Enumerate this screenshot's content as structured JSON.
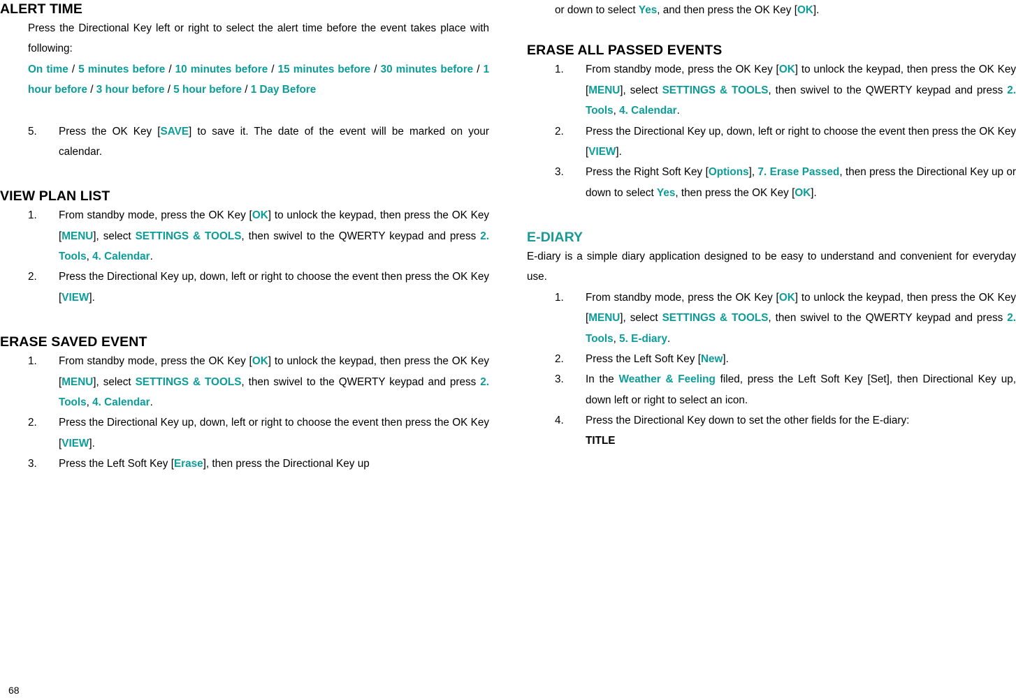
{
  "page_number": "68",
  "left_column": {
    "alert_time": {
      "heading": "ALERT TIME",
      "intro_line1": "Press the Directional Key left or right to select the alert time before the",
      "intro_line2": "event takes place with following:",
      "options": [
        "On time",
        "5 minutes before",
        "10 minutes before",
        "15 minutes before",
        "30 minutes before",
        "1 hour before",
        "3 hour before",
        "5 hour before",
        "1 Day Before"
      ],
      "step5_num": "5.",
      "step5_a": "Press the OK Key [",
      "step5_key": "SAVE",
      "step5_b": "] to save it. The date of the event will be marked on your calendar."
    },
    "view_plan_list": {
      "heading": "VIEW PLAN LIST",
      "step1": {
        "num": "1.",
        "t1": "From standby mode, press the OK Key [",
        "k1": "OK",
        "t2": "] to unlock the keypad, then press the OK Key [",
        "k2": "MENU",
        "t3": "], select ",
        "k3": "SETTINGS & TOOLS",
        "t4": ", then swivel to the QWERTY keypad and press ",
        "k4": "2. Tools",
        "t5": ", ",
        "k5": "4. Calendar",
        "t6": "."
      },
      "step2": {
        "num": "2.",
        "t1": "Press the Directional Key up, down, left or right to choose the event then press the OK Key [",
        "k1": "VIEW",
        "t2": "]."
      }
    },
    "erase_saved_event": {
      "heading": "ERASE SAVED EVENT",
      "step1": {
        "num": "1.",
        "t1": "From standby mode, press the OK Key [",
        "k1": "OK",
        "t2": "] to unlock the keypad, then press the OK Key [",
        "k2": "MENU",
        "t3": "], select ",
        "k3": "SETTINGS & TOOLS",
        "t4": ", then swivel to the QWERTY keypad and press ",
        "k4": "2. Tools",
        "t5": ", ",
        "k5": "4. Calendar",
        "t6": "."
      },
      "step2": {
        "num": "2.",
        "t1": "Press the Directional Key up, down, left or right to choose the event then press the OK Key [",
        "k1": "VIEW",
        "t2": "]."
      },
      "step3": {
        "num": "3.",
        "t1": "Press the Left Soft Key [",
        "k1": "Erase",
        "t2": "], then press the Directional Key up"
      }
    }
  },
  "right_column": {
    "continued": {
      "t1": "or down to select ",
      "k1": "Yes",
      "t2": ", and then press the OK Key [",
      "k2": "OK",
      "t3": "]."
    },
    "erase_all_passed": {
      "heading": "ERASE ALL PASSED EVENTS",
      "step1": {
        "num": "1.",
        "t1": "From standby mode, press the OK Key [",
        "k1": "OK",
        "t2": "] to unlock the keypad, then press the OK Key [",
        "k2": "MENU",
        "t3": "], select ",
        "k3": "SETTINGS & TOOLS",
        "t4": ", then swivel to the QWERTY keypad and press ",
        "k4": "2. Tools",
        "t5": ", ",
        "k5": "4. Calendar",
        "t6": "."
      },
      "step2": {
        "num": "2.",
        "t1": "Press the Directional Key up, down, left or right to choose the event then press the OK Key [",
        "k1": "VIEW",
        "t2": "]."
      },
      "step3": {
        "num": "3.",
        "t1": "Press the Right Soft Key [",
        "k1": "Options",
        "t2": "], ",
        "k2": "7. Erase Passed",
        "t3": ", then press the Directional Key up or down to select ",
        "k3": "Yes",
        "t4": ", then press the OK Key [",
        "k4": "OK",
        "t5": "]."
      }
    },
    "e_diary": {
      "heading": "E-DIARY",
      "intro_line1": "E-diary is a simple diary application designed to be easy to understand and",
      "intro_line2": "convenient for everyday use.",
      "step1": {
        "num": "1.",
        "t1": "From standby mode, press the OK Key [",
        "k1": "OK",
        "t2": "] to unlock the keypad, then press the OK Key [",
        "k2": "MENU",
        "t3": "], select ",
        "k3": "SETTINGS & TOOLS",
        "t4": ", then swivel to the QWERTY keypad and press ",
        "k4": "2. Tools",
        "t5": ", ",
        "k5": "5. E-diary",
        "t6": "."
      },
      "step2": {
        "num": "2.",
        "t1": "Press the Left Soft Key [",
        "k1": "New",
        "t2": "]."
      },
      "step3": {
        "num": "3.",
        "t1": "In the ",
        "k1": "Weather & Feeling",
        "t2": " filed, press the Left Soft Key [Set], then Directional Key up, down left or right to select an icon."
      },
      "step4": {
        "num": "4.",
        "t1": "Press the Directional Key down to set the other fields for the E-diary:"
      },
      "title_label": "TITLE"
    }
  }
}
